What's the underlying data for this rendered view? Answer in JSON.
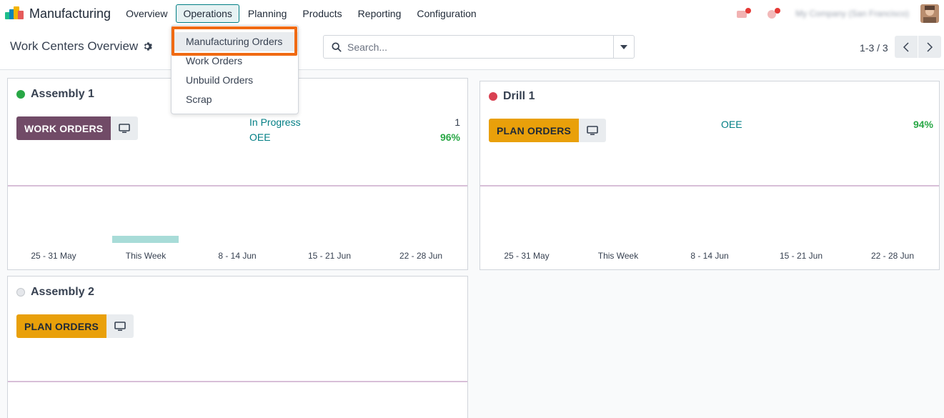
{
  "navbar": {
    "app_name": "Manufacturing",
    "menu": [
      {
        "label": "Overview"
      },
      {
        "label": "Operations"
      },
      {
        "label": "Planning"
      },
      {
        "label": "Products"
      },
      {
        "label": "Reporting"
      },
      {
        "label": "Configuration"
      }
    ],
    "company_name": "My Company (San Francisco)",
    "brand_colors": [
      "#e55b5b",
      "#f4b400",
      "#1ebd8b",
      "#0b86b8"
    ]
  },
  "control_panel": {
    "title": "Work Centers Overview",
    "search_placeholder": "Search...",
    "pager": "1-3 / 3"
  },
  "operations_menu": {
    "items": [
      {
        "label": "Manufacturing Orders"
      },
      {
        "label": "Work Orders"
      },
      {
        "label": "Unbuild Orders"
      },
      {
        "label": "Scrap"
      }
    ]
  },
  "cards": [
    {
      "name": "Assembly 1",
      "status_color": "#28a745",
      "button_label": "WORK ORDERS",
      "stats": [
        {
          "label": "In Progress",
          "value": "1"
        },
        {
          "label": "OEE",
          "value": "96%"
        }
      ],
      "ticks": [
        "25 - 31 May",
        "This Week",
        "8 - 14 Jun",
        "15 - 21 Jun",
        "22 - 28 Jun"
      ]
    },
    {
      "name": "Drill 1",
      "status_color": "#dc3545",
      "button_label": "PLAN ORDERS",
      "stats": [
        {
          "label": "OEE",
          "value": "94%"
        }
      ],
      "ticks": [
        "25 - 31 May",
        "This Week",
        "8 - 14 Jun",
        "15 - 21 Jun",
        "22 - 28 Jun"
      ]
    },
    {
      "name": "Assembly 2",
      "status_color": "#e5e7eb",
      "button_label": "PLAN ORDERS"
    }
  ]
}
